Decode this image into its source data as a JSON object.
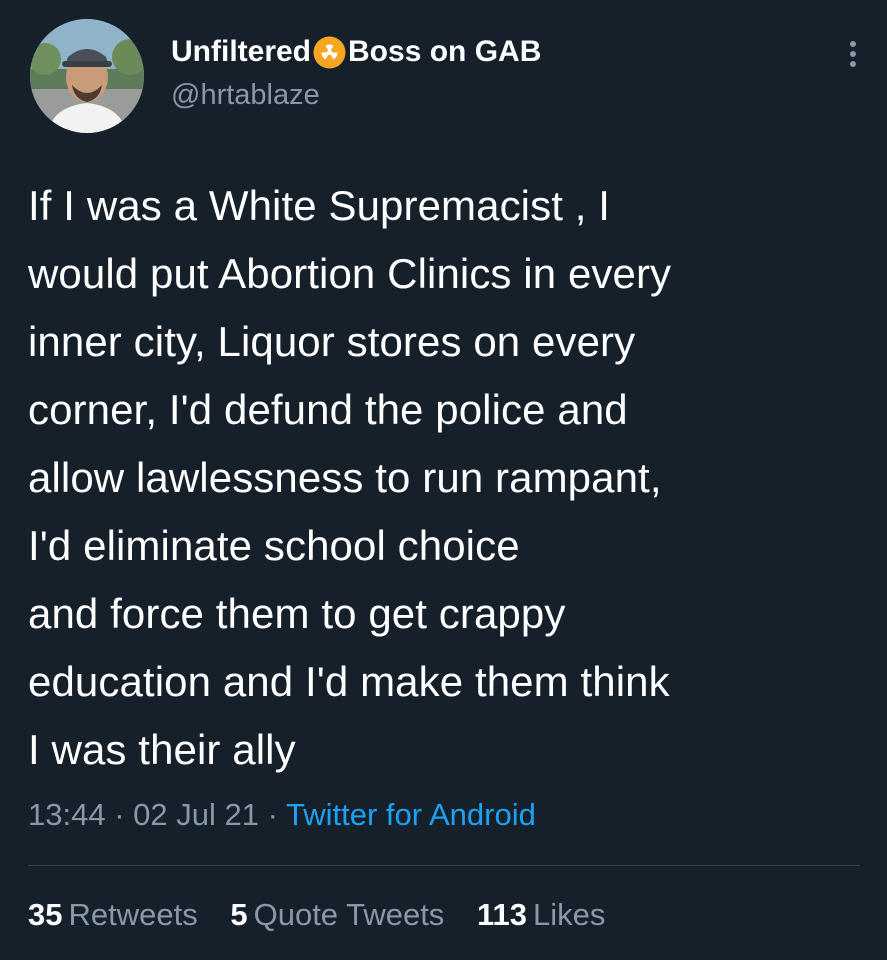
{
  "user": {
    "display_name_part1": "Unfiltered",
    "display_name_emoji": "radiation-icon",
    "display_name_part2": "Boss on GAB",
    "handle": "@hrtablaze"
  },
  "tweet": {
    "lines": [
      "If I was a White Supremacist , I",
      "would put Abortion Clinics in every",
      "inner city, Liquor stores on every",
      "corner, I'd defund the police and",
      "allow lawlessness to run rampant,",
      "I'd eliminate school choice",
      "and force them to get crappy",
      "education and I'd make them think",
      "I was their ally"
    ]
  },
  "meta": {
    "time": "13:44",
    "separator": "·",
    "date": "02 Jul 21",
    "source": "Twitter for Android"
  },
  "stats": {
    "retweets_count": "35",
    "retweets_label": "Retweets",
    "quotes_count": "5",
    "quotes_label": "Quote Tweets",
    "likes_count": "113",
    "likes_label": "Likes"
  },
  "colors": {
    "background": "#15202b",
    "text_primary": "#ffffff",
    "text_secondary": "#8899a6",
    "link": "#1da1f2",
    "divider": "#38444d"
  }
}
